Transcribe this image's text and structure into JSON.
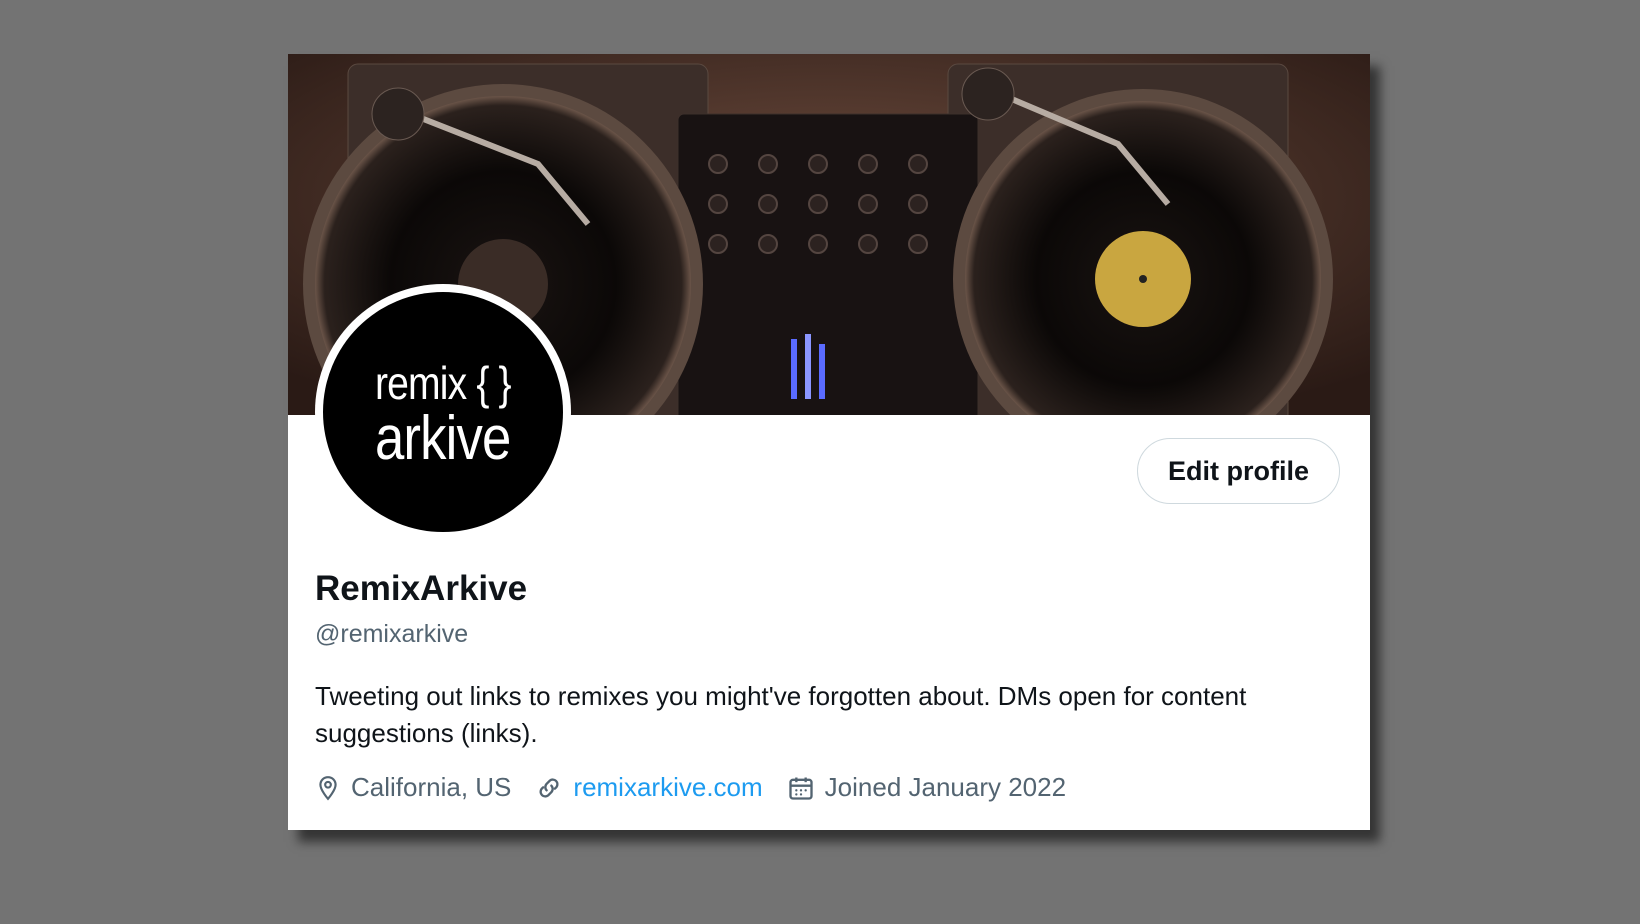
{
  "profile": {
    "display_name": "RemixArkive",
    "handle": "@remixarkive",
    "bio": "Tweeting out links to remixes you might've forgotten about.  DMs open for content suggestions (links).",
    "avatar_logo": {
      "line1": "remix { }",
      "line2": "arkive"
    },
    "banner_icon": "dj-turntables-photo"
  },
  "actions": {
    "edit_profile_label": "Edit profile"
  },
  "meta": {
    "location": "California, US",
    "location_icon": "location-pin-icon",
    "website": "remixarkive.com",
    "website_icon": "link-icon",
    "joined": "Joined January 2022",
    "joined_icon": "calendar-icon"
  },
  "colors": {
    "background": "#737373",
    "link": "#1d9bf0",
    "secondary_text": "#536471",
    "primary_text": "#0f1419"
  }
}
